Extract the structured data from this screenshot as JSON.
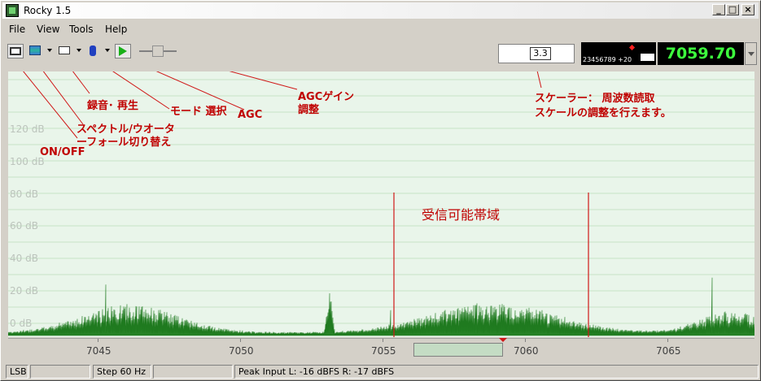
{
  "window": {
    "title": "Rocky 1.5",
    "minimize": "_",
    "maximize": "□",
    "close": "×"
  },
  "menu": {
    "file": "File",
    "view": "View",
    "tools": "Tools",
    "help": "Help"
  },
  "toolbar": {
    "scale_value": "3.3",
    "smeter_scale": "23456789 +20",
    "frequency": "7059.70"
  },
  "spectrum": {
    "db_labels": [
      "120 dB",
      "100 dB",
      "80 dB",
      "60 dB",
      "40 dB",
      "20 dB",
      "0 dB"
    ],
    "freq_labels": [
      "7045",
      "7050",
      "7055",
      "7060",
      "7065"
    ]
  },
  "annotations": {
    "onoff": "ON/OFF",
    "spectrum_switch_1": "スペクトル/ウオータ",
    "spectrum_switch_2": "ーフォール切り替え",
    "record": "録音･ 再生",
    "mode": "モード 選択",
    "agc": "AGC",
    "agc_gain_1": "AGCゲイン",
    "agc_gain_2": "調整",
    "scaler_1": "スケーラー：  周波数読取",
    "scaler_2": "スケールの調整を行えます。",
    "passband": "受信可能帯域"
  },
  "statusbar": {
    "mode": "LSB",
    "step": "Step 60 Hz",
    "peak_input": "Peak Input   L: -16 dBFS    R: -17 dBFS"
  },
  "colors": {
    "annotation": "#c00000",
    "spectrum": "#2a8a2a",
    "freq_display": "#3dff3d"
  }
}
